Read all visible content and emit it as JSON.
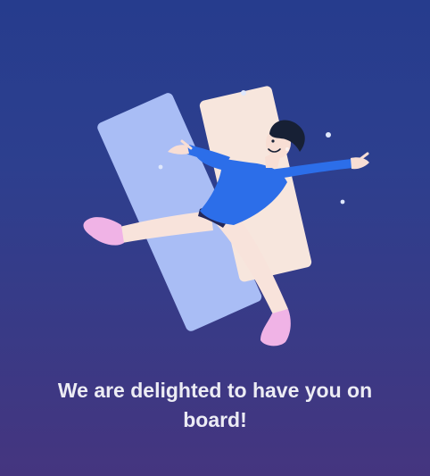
{
  "onboarding": {
    "message": "We are delighted to have you on board!"
  },
  "illustration": {
    "icon": "celebrating-person-illustration",
    "colors": {
      "background_top": "#263c8d",
      "background_bottom": "#45357f",
      "back_card": "#a9bdf5",
      "front_card": "#f7e6dd",
      "shirt": "#2c6ee9",
      "pants": "#f8e3db",
      "shoes": "#f0b3e6",
      "skin": "#f8ded4",
      "hair": "#172035",
      "sparkles": "#dfe7fb"
    }
  }
}
